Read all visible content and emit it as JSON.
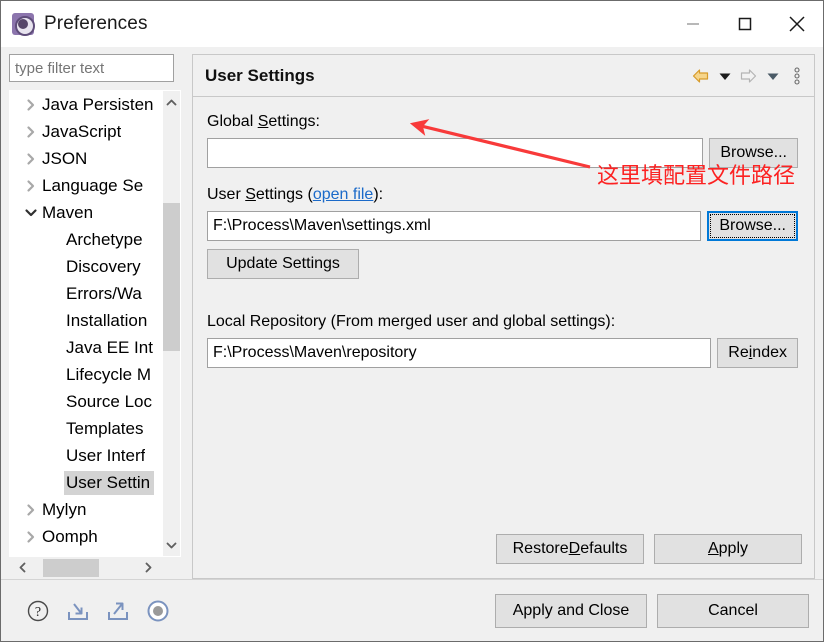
{
  "window": {
    "title": "Preferences",
    "icon": "preferences-gear-icon",
    "controls": {
      "minimize": "minimize-icon",
      "maximize": "maximize-icon",
      "close": "close-icon"
    }
  },
  "sidebar": {
    "filter": {
      "value": "",
      "placeholder": "type filter text"
    },
    "items": [
      {
        "label": "Java Persisten",
        "level": 0,
        "expandable": true,
        "expanded": false,
        "selected": false
      },
      {
        "label": "JavaScript",
        "level": 0,
        "expandable": true,
        "expanded": false,
        "selected": false
      },
      {
        "label": "JSON",
        "level": 0,
        "expandable": true,
        "expanded": false,
        "selected": false
      },
      {
        "label": "Language Se",
        "level": 0,
        "expandable": true,
        "expanded": false,
        "selected": false
      },
      {
        "label": "Maven",
        "level": 0,
        "expandable": true,
        "expanded": true,
        "selected": false
      },
      {
        "label": "Archetype",
        "level": 1,
        "expandable": false,
        "expanded": false,
        "selected": false
      },
      {
        "label": "Discovery",
        "level": 1,
        "expandable": false,
        "expanded": false,
        "selected": false
      },
      {
        "label": "Errors/Wa",
        "level": 1,
        "expandable": false,
        "expanded": false,
        "selected": false
      },
      {
        "label": "Installation",
        "level": 1,
        "expandable": false,
        "expanded": false,
        "selected": false
      },
      {
        "label": "Java EE Int",
        "level": 1,
        "expandable": false,
        "expanded": false,
        "selected": false
      },
      {
        "label": "Lifecycle M",
        "level": 1,
        "expandable": false,
        "expanded": false,
        "selected": false
      },
      {
        "label": "Source Loc",
        "level": 1,
        "expandable": false,
        "expanded": false,
        "selected": false
      },
      {
        "label": "Templates",
        "level": 1,
        "expandable": false,
        "expanded": false,
        "selected": false
      },
      {
        "label": "User Interf",
        "level": 1,
        "expandable": false,
        "expanded": false,
        "selected": false
      },
      {
        "label": "User Settin",
        "level": 1,
        "expandable": false,
        "expanded": false,
        "selected": true
      },
      {
        "label": "Mylyn",
        "level": 0,
        "expandable": true,
        "expanded": false,
        "selected": false
      },
      {
        "label": "Oomph",
        "level": 0,
        "expandable": true,
        "expanded": false,
        "selected": false
      }
    ],
    "scroll": {
      "vertical_up_icon": "chevron-up-icon",
      "vertical_down_icon": "chevron-down-icon",
      "horizontal_left_icon": "chevron-left-icon",
      "horizontal_right_icon": "chevron-right-icon"
    }
  },
  "page": {
    "title": "User Settings",
    "header_tools": [
      {
        "name": "back-arrow-icon",
        "enabled": true
      },
      {
        "name": "back-dropdown-icon",
        "enabled": true
      },
      {
        "name": "forward-arrow-icon",
        "enabled": false
      },
      {
        "name": "forward-dropdown-icon",
        "enabled": true
      },
      {
        "name": "view-menu-icon",
        "enabled": true
      }
    ],
    "global_settings": {
      "label_pre": "Global ",
      "label_mnemonic": "S",
      "label_post": "ettings:",
      "value": "",
      "browse_label": "Browse..."
    },
    "user_settings": {
      "label_pre": "User ",
      "label_mnemonic": "S",
      "label_mid": "ettings (",
      "link_text": "open file",
      "label_post": "):",
      "value": "F:\\Process\\Maven\\settings.xml",
      "browse_label": "Browse...",
      "update_label": "Update Settings"
    },
    "local_repository": {
      "label": "Local Repository (From merged user and global settings):",
      "value": "F:\\Process\\Maven\\repository",
      "reindex_pre": "Re",
      "reindex_mnemonic": "i",
      "reindex_post": "ndex"
    },
    "restore_defaults": {
      "pre": "Restore ",
      "mnemonic": "D",
      "post": "efaults"
    },
    "apply": {
      "mnemonic": "A",
      "post": "pply"
    }
  },
  "annotation": {
    "text": "这里填配置文件路径",
    "color": "#fc2222",
    "arrow_name": "red-pointer-arrow"
  },
  "footer": {
    "icons": [
      {
        "name": "help-icon"
      },
      {
        "name": "import-preferences-icon"
      },
      {
        "name": "export-preferences-icon"
      },
      {
        "name": "oomph-recorder-icon"
      }
    ],
    "apply_and_close_label": "Apply and Close",
    "cancel_label": "Cancel"
  },
  "colors": {
    "dialog_bg": "#f0f0f0",
    "titlebar_bg": "#ffffff",
    "tree_bg": "#ffffff",
    "selection": "#d3d3d3",
    "link": "#1b6ac9",
    "annotation": "#fc2222",
    "focus": "#0078d7",
    "back_arrow": "#e8a33d"
  }
}
